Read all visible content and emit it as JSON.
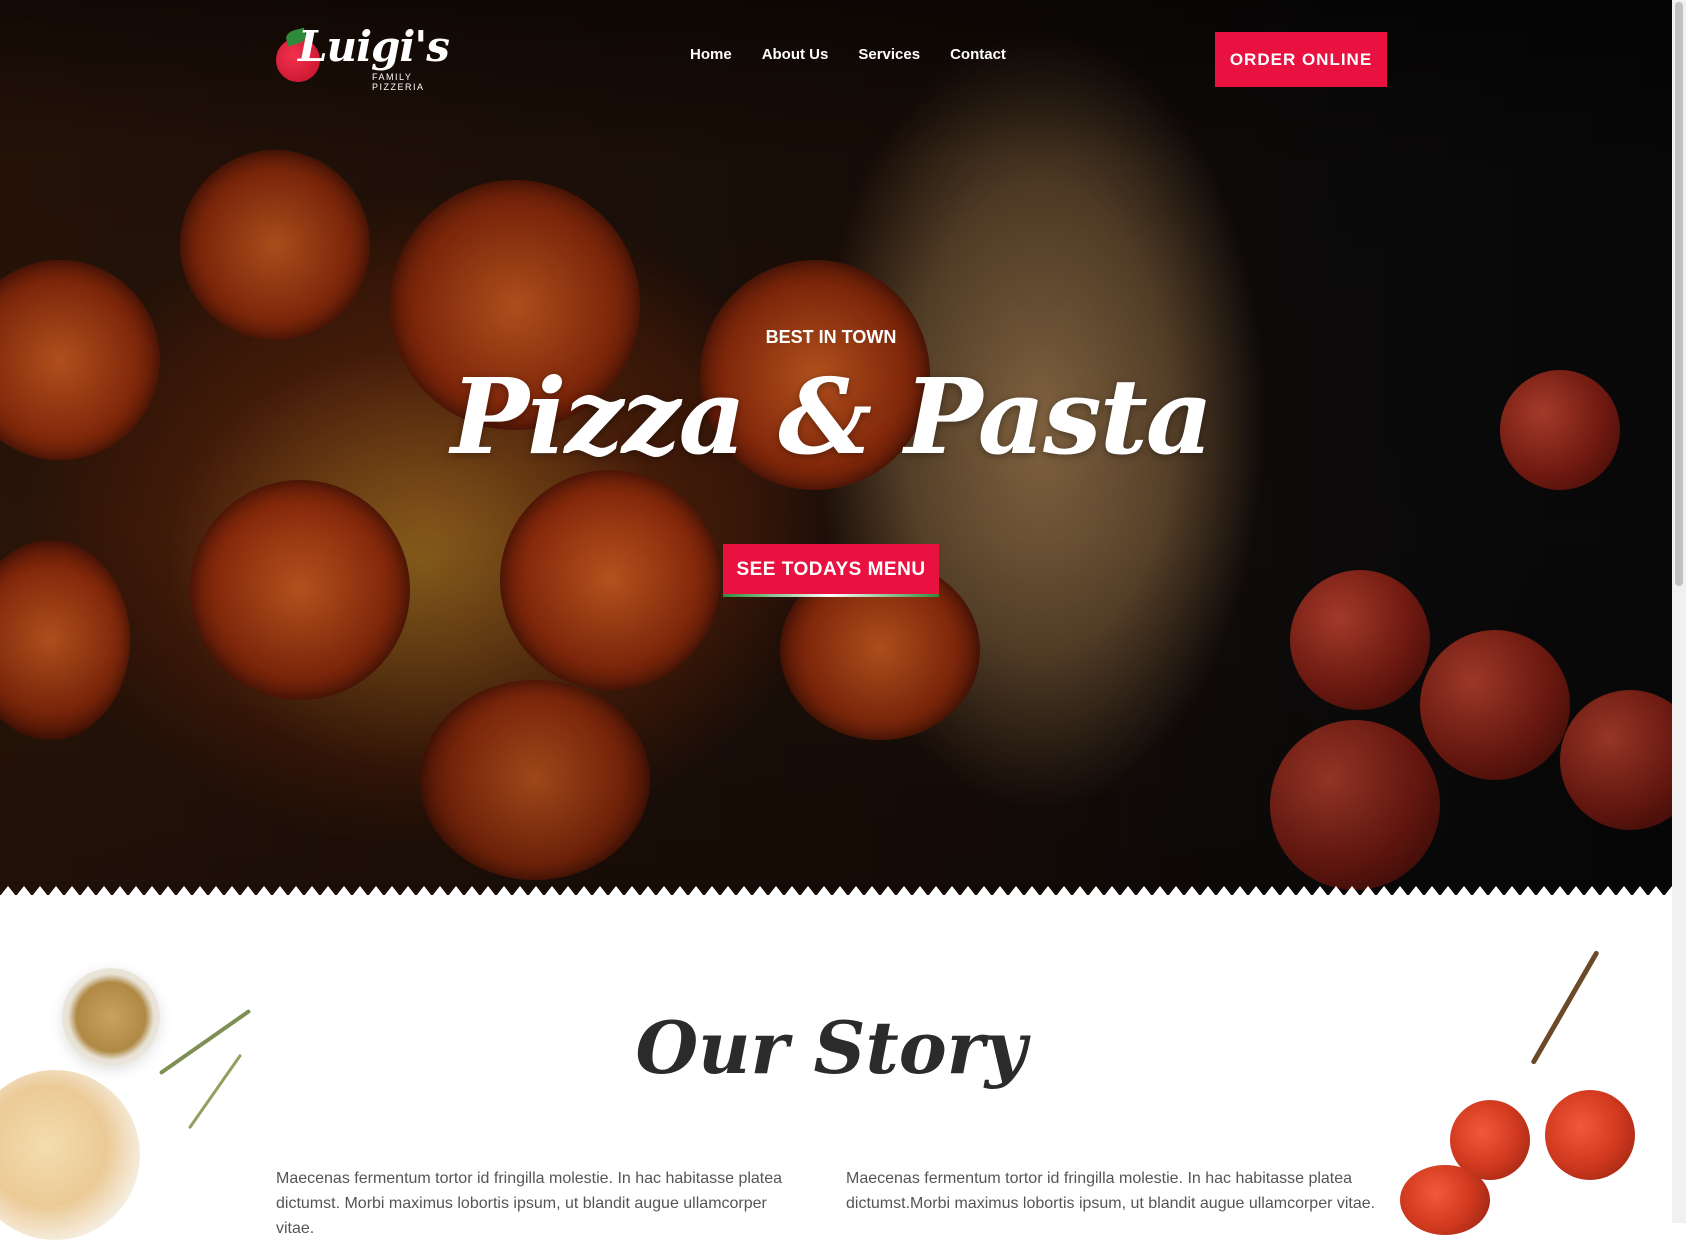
{
  "header": {
    "logo_name": "Luigi's",
    "logo_subtitle": "FAMILY PIZZERIA",
    "nav": [
      "Home",
      "About Us",
      "Services",
      "Contact"
    ],
    "order_button": "ORDER ONLINE"
  },
  "hero": {
    "kicker": "BEST IN TOWN",
    "headline": "Pizza & Pasta",
    "menu_button": "SEE TODAYS MENU"
  },
  "story": {
    "title": "Our Story",
    "col1": "Maecenas fermentum tortor id fringilla molestie. In hac habitasse platea dictumst. Morbi maximus lobortis ipsum, ut blandit augue ullamcorper vitae.",
    "col2": "Maecenas fermentum tortor id fringilla molestie. In hac habitasse platea dictumst.Morbi maximus lobortis ipsum, ut blandit augue ullamcorper vitae."
  },
  "colors": {
    "accent": "#e8113f",
    "accent_green": "#2e8b3a",
    "heading_dark": "#2b2b2b",
    "body_text": "#555555"
  },
  "icons": [
    "tomato-logo-icon",
    "leaf-icon"
  ]
}
